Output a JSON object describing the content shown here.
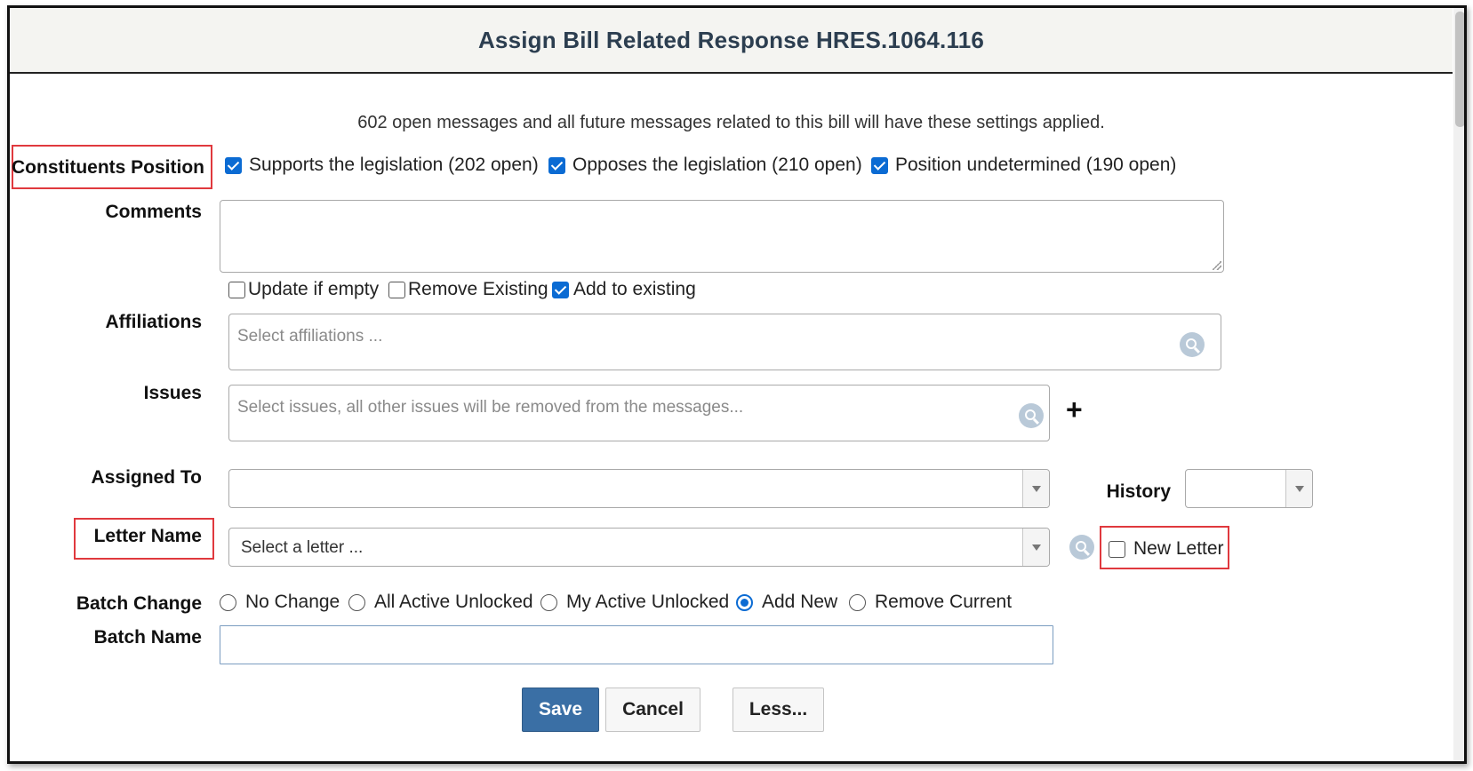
{
  "dialog": {
    "title": "Assign Bill Related Response HRES.1064.116",
    "info": "602 open messages and all future messages related to this bill will have these settings applied."
  },
  "position": {
    "label": "Constituents Position",
    "options": [
      {
        "label": "Supports the legislation (202 open)",
        "checked": true
      },
      {
        "label": "Opposes the legislation (210 open)",
        "checked": true
      },
      {
        "label": "Position undetermined (190 open)",
        "checked": true
      }
    ]
  },
  "comments": {
    "label": "Comments",
    "value": "",
    "options": [
      {
        "label": "Update if empty",
        "checked": false
      },
      {
        "label": "Remove Existing",
        "checked": false
      },
      {
        "label": "Add to existing",
        "checked": true
      }
    ]
  },
  "affiliations": {
    "label": "Affiliations",
    "placeholder": "Select affiliations ..."
  },
  "issues": {
    "label": "Issues",
    "placeholder": "Select issues, all other issues will be removed from the messages...",
    "add_symbol": "+"
  },
  "assigned_to": {
    "label": "Assigned To",
    "value": ""
  },
  "history": {
    "label": "History",
    "value": ""
  },
  "letter": {
    "label": "Letter Name",
    "placeholder": "Select a letter ...",
    "new_letter_label": "New Letter",
    "new_letter_checked": false
  },
  "batch_change": {
    "label": "Batch Change",
    "options": [
      {
        "label": "No Change",
        "selected": false
      },
      {
        "label": "All Active Unlocked",
        "selected": false
      },
      {
        "label": "My Active Unlocked",
        "selected": false
      },
      {
        "label": "Add New",
        "selected": true
      },
      {
        "label": "Remove Current",
        "selected": false
      }
    ]
  },
  "batch_name": {
    "label": "Batch Name",
    "value": ""
  },
  "buttons": {
    "save": "Save",
    "cancel": "Cancel",
    "less": "Less..."
  },
  "colors": {
    "accent": "#0b6bd3",
    "highlight": "#e0393e",
    "primary_button": "#3a6fa5",
    "title_text": "#2c3e50"
  },
  "icons": [
    "search-icon",
    "plus-icon",
    "dropdown-arrow-icon",
    "resize-grip-icon"
  ]
}
